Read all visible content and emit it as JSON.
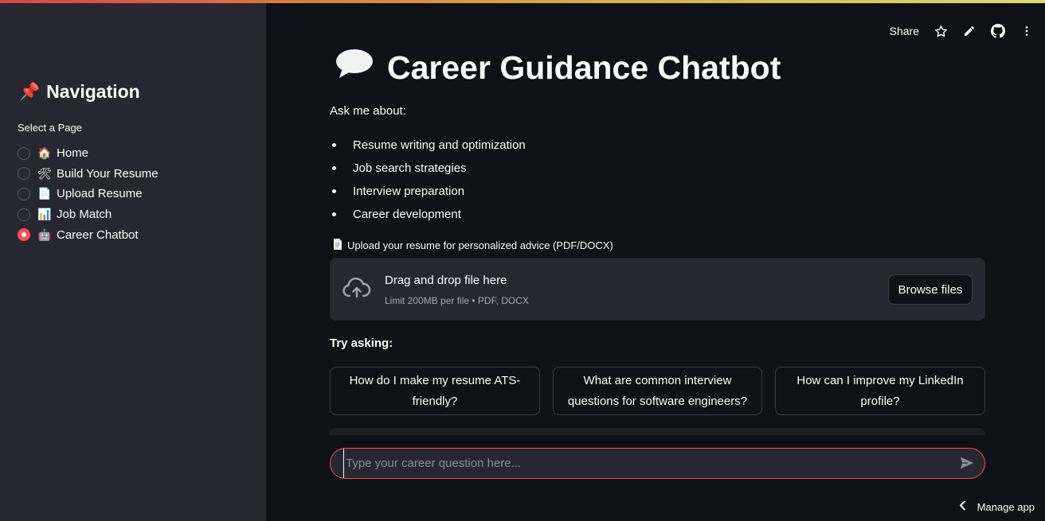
{
  "sidebar": {
    "title": "Navigation",
    "title_icon": "📌",
    "select_label": "Select a Page",
    "items": [
      {
        "icon": "🏠",
        "label": "Home",
        "checked": false
      },
      {
        "icon": "🛠",
        "label": "Build Your Resume",
        "checked": false
      },
      {
        "icon": "📄",
        "label": "Upload Resume",
        "checked": false
      },
      {
        "icon": "📊",
        "label": "Job Match",
        "checked": false
      },
      {
        "icon": "🤖",
        "label": "Career Chatbot",
        "checked": true
      }
    ]
  },
  "toolbar": {
    "share_label": "Share",
    "icons": [
      "star-icon",
      "edit-icon",
      "github-icon",
      "more-vertical-icon"
    ]
  },
  "main": {
    "title": "Career Guidance Chatbot",
    "title_icon": "💬",
    "intro": "Ask me about:",
    "topics": [
      "Resume writing and optimization",
      "Job search strategies",
      "Interview preparation",
      "Career development"
    ],
    "upload": {
      "icon": "📄",
      "label": "Upload your resume for personalized advice (PDF/DOCX)",
      "drop_title": "Drag and drop file here",
      "drop_limit": "Limit 200MB per file • PDF, DOCX",
      "browse_label": "Browse files"
    },
    "try_label": "Try asking:",
    "suggestions": [
      "How do I make my resume ATS-friendly?",
      "What are common interview questions for software engineers?",
      "How can I improve my LinkedIn profile?"
    ],
    "chat": {
      "placeholder": "Type your career question here..."
    }
  },
  "footer": {
    "manage_label": "Manage app"
  },
  "colors": {
    "background": "#0e1117",
    "sidebar": "#262730",
    "accent": "#ff4b4b",
    "text": "#fafafa"
  }
}
